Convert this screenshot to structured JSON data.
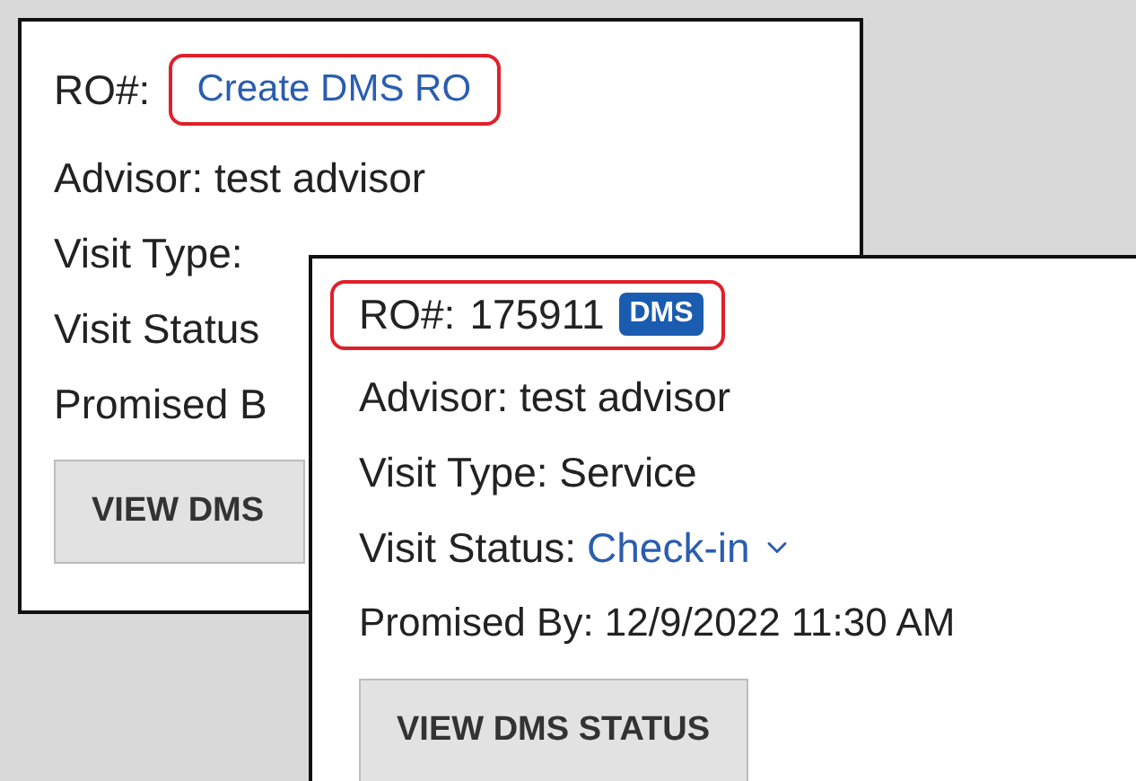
{
  "back_card": {
    "ro_label": "RO#:",
    "ro_link": "Create DMS RO",
    "highlighted": true,
    "advisor": "Advisor: test advisor",
    "visit_type": "Visit Type:",
    "visit_status": "Visit Status",
    "promised": "Promised B",
    "button": "VIEW DMS"
  },
  "front_card": {
    "ro_label": "RO#:",
    "ro_number": "175911",
    "badge": "DMS",
    "highlighted": true,
    "advisor": "Advisor: test advisor",
    "visit_type": "Visit Type: Service",
    "visit_status_label": "Visit Status:",
    "visit_status_value": "Check-in",
    "promised": "Promised By: 12/9/2022 11:30 AM",
    "button": "VIEW DMS STATUS"
  }
}
